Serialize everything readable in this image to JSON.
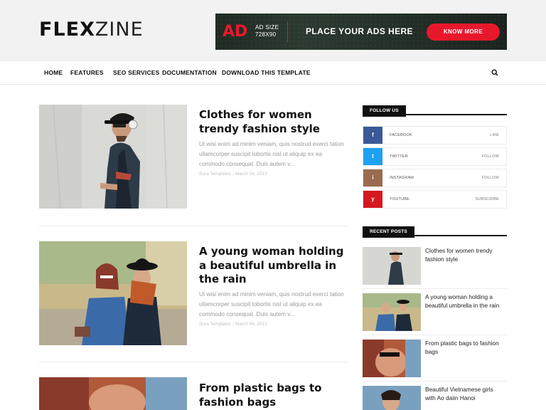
{
  "header": {
    "logo_bold": "FLEX",
    "logo_light": "ZINE",
    "ad": {
      "ad_word": "AD",
      "size_label": "AD SIZE",
      "size_value": "728X90",
      "text": "PLACE YOUR ADS HERE",
      "button": "KNOW MORE"
    }
  },
  "nav": {
    "items": [
      "HOME",
      "FEATURES",
      "SEO SERVICES",
      "DOCUMENTATION",
      "DOWNLOAD THIS TEMPLATE"
    ],
    "search_icon": "search-icon"
  },
  "posts": [
    {
      "title": "Clothes for women trendy fashion style",
      "excerpt": "Ut wisi enim ad minim veniam, quis nostrud exerci tation ullamcorper suscipit lobortis nisl ut aliquip ex ea commodo consequat. Duis autem v...",
      "meta": "Sora Templates - March 04, 2015"
    },
    {
      "title": "A young woman holding a beautiful umbrella in the rain",
      "excerpt": "Ut wisi enim ad minim veniam, quis nostrud exerci tation ullamcorper suscipit lobortis nisl ut aliquip ex ea commodo consequat. Duis autem v...",
      "meta": "Sora Templates - March 04, 2015"
    },
    {
      "title": "From plastic bags to fashion bags"
    }
  ],
  "sidebar": {
    "follow_title": "FOLLOW US",
    "social": [
      {
        "icon": "f",
        "name": "FACEBOOK",
        "action": "LIKE",
        "color": "#3b5998"
      },
      {
        "icon": "t",
        "name": "TWITTER",
        "action": "FOLLOW",
        "color": "#1da1f2"
      },
      {
        "icon": "i",
        "name": "INSTAGRAM",
        "action": "FOLLOW",
        "color": "#9b6b4f"
      },
      {
        "icon": "y",
        "name": "YOUTUBE",
        "action": "SUBSCRIBE",
        "color": "#d4181f"
      }
    ],
    "recent_title": "RECENT POSTS",
    "recent": [
      "Clothes for women trendy fashion style",
      "A young woman holding a beautiful umbrella in the rain",
      "From plastic bags to fashion bags",
      "Beautiful Vietnamese girls with Ao daiin Hanoi"
    ]
  },
  "colors": {
    "accent": "#e8182c",
    "text_dark": "#111111",
    "text_muted": "#9a9a9a"
  }
}
